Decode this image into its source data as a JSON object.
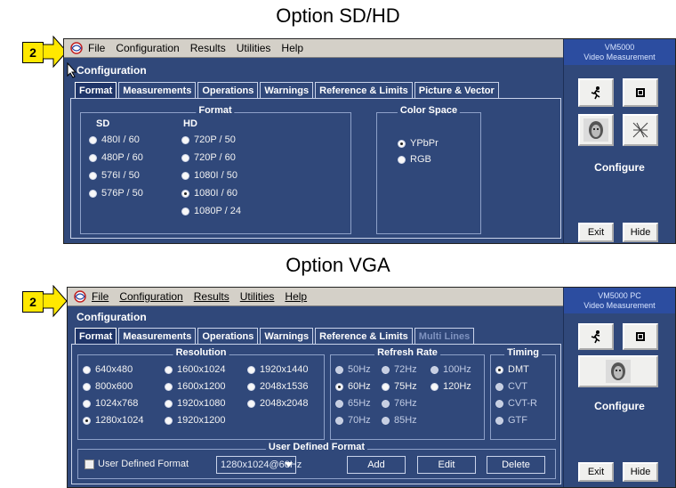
{
  "captions": {
    "top": "Option SD/HD",
    "bottom": "Option VGA"
  },
  "badge": "2",
  "top_window": {
    "menu": [
      "File",
      "Configuration",
      "Results",
      "Utilities",
      "Help"
    ],
    "brand": [
      "VM5000",
      "Video Measurement"
    ],
    "title": "Configuration",
    "tabs": [
      "Format",
      "Measurements",
      "Operations",
      "Warnings",
      "Reference & Limits",
      "Picture & Vector"
    ],
    "format_group": "Format",
    "col_sd": "SD",
    "col_hd": "HD",
    "sd_options": [
      "480I / 60",
      "480P / 60",
      "576I / 50",
      "576P / 50"
    ],
    "hd_options": [
      "720P / 50",
      "720P / 60",
      "1080I / 50",
      "1080I / 60",
      "1080P / 24"
    ],
    "color_group": "Color Space",
    "color_options": [
      "YPbPr",
      "RGB"
    ],
    "configure": "Configure",
    "exit": "Exit",
    "hide": "Hide"
  },
  "bottom_window": {
    "menu": [
      "File",
      "Configuration",
      "Results",
      "Utilities",
      "Help"
    ],
    "brand": [
      "VM5000 PC",
      "Video Measurement"
    ],
    "title": "Configuration",
    "tabs": [
      "Format",
      "Measurements",
      "Operations",
      "Warnings",
      "Reference & Limits",
      "Multi Lines"
    ],
    "resolution_group": "Resolution",
    "resolutions": [
      "640x480",
      "800x600",
      "1024x768",
      "1280x1024",
      "1600x1024",
      "1600x1200",
      "1920x1080",
      "1920x1200",
      "1920x1440",
      "2048x1536",
      "2048x2048"
    ],
    "refresh_group": "Refresh Rate",
    "refresh": [
      "50Hz",
      "60Hz",
      "65Hz",
      "70Hz",
      "72Hz",
      "75Hz",
      "76Hz",
      "85Hz",
      "100Hz",
      "120Hz"
    ],
    "timing_group": "Timing",
    "timing": [
      "DMT",
      "CVT",
      "CVT-R",
      "GTF"
    ],
    "udf_group": "User Defined Format",
    "udf_checkbox": "User Defined Format",
    "udf_value": "1280x1024@60Hz",
    "add": "Add",
    "edit": "Edit",
    "delete": "Delete",
    "configure": "Configure",
    "exit": "Exit",
    "hide": "Hide"
  }
}
